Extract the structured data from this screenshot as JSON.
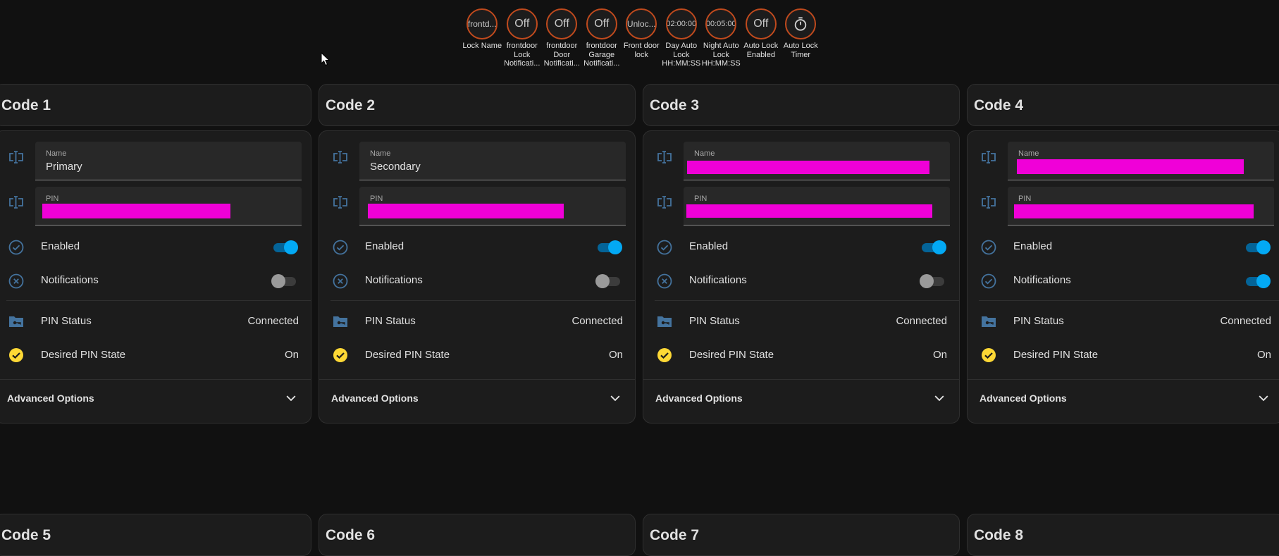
{
  "badges": [
    {
      "value": "frontd...",
      "label": "Lock Name",
      "size": "small"
    },
    {
      "value": "Off",
      "label": "frontdoor Lock Notificati...",
      "size": "normal"
    },
    {
      "value": "Off",
      "label": "frontdoor Door Notificati...",
      "size": "normal"
    },
    {
      "value": "Off",
      "label": "frontdoor Garage Notificati...",
      "size": "normal"
    },
    {
      "value": "Unloc...",
      "label": "Front door lock",
      "size": "small"
    },
    {
      "value": "02:00:00",
      "label": "Day Auto Lock HH:MM:SS",
      "size": "tiny"
    },
    {
      "value": "00:05:00",
      "label": "Night Auto Lock HH:MM:SS",
      "size": "tiny"
    },
    {
      "value": "Off",
      "label": "Auto Lock Enabled",
      "size": "normal"
    },
    {
      "value": "",
      "label": "Auto Lock Timer",
      "size": "icon",
      "icon": "timer-icon"
    }
  ],
  "codes": [
    {
      "title": "Code 1",
      "name_label": "Name",
      "name_value": "Primary",
      "name_redacted": false,
      "pin_label": "PIN",
      "pin_redacted": true,
      "enabled_label": "Enabled",
      "enabled": true,
      "notifications_label": "Notifications",
      "notifications": false,
      "pin_status_label": "PIN Status",
      "pin_status": "Connected",
      "desired_label": "Desired PIN State",
      "desired_value": "On",
      "advanced_label": "Advanced Options"
    },
    {
      "title": "Code 2",
      "name_label": "Name",
      "name_value": "Secondary",
      "name_redacted": false,
      "pin_label": "PIN",
      "pin_redacted": true,
      "enabled_label": "Enabled",
      "enabled": true,
      "notifications_label": "Notifications",
      "notifications": false,
      "pin_status_label": "PIN Status",
      "pin_status": "Connected",
      "desired_label": "Desired PIN State",
      "desired_value": "On",
      "advanced_label": "Advanced Options"
    },
    {
      "title": "Code 3",
      "name_label": "Name",
      "name_value": "",
      "name_redacted": true,
      "pin_label": "PIN",
      "pin_redacted": true,
      "enabled_label": "Enabled",
      "enabled": true,
      "notifications_label": "Notifications",
      "notifications": false,
      "pin_status_label": "PIN Status",
      "pin_status": "Connected",
      "desired_label": "Desired PIN State",
      "desired_value": "On",
      "advanced_label": "Advanced Options"
    },
    {
      "title": "Code 4",
      "name_label": "Name",
      "name_value": "",
      "name_redacted": true,
      "pin_label": "PIN",
      "pin_redacted": true,
      "enabled_label": "Enabled",
      "enabled": true,
      "notifications_label": "Notifications",
      "notifications": true,
      "pin_status_label": "PIN Status",
      "pin_status": "Connected",
      "desired_label": "Desired PIN State",
      "desired_value": "On",
      "advanced_label": "Advanced Options"
    }
  ],
  "bottom_titles": [
    "Code 5",
    "Code 6",
    "Code 7",
    "Code 8"
  ],
  "colors": {
    "background": "#111111",
    "card": "#1c1c1c",
    "badge_border": "#c04a1d",
    "toggle_on": "#03a9f4",
    "icon_blue": "#44739e",
    "check_yellow": "#fdd835",
    "redaction": "#f000d8"
  }
}
